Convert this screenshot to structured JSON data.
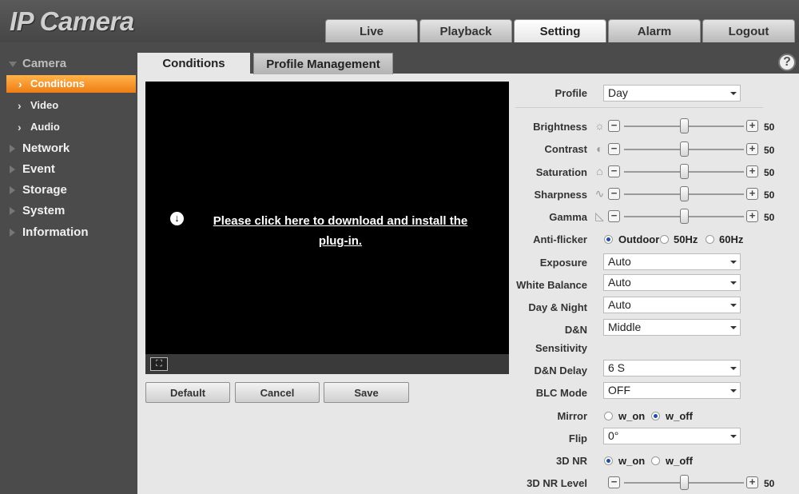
{
  "app": {
    "logo": "IP Camera"
  },
  "topnav": [
    "Live",
    "Playback",
    "Setting",
    "Alarm",
    "Logout"
  ],
  "sidebar": {
    "camera": "Camera",
    "conditions": "Conditions",
    "video": "Video",
    "audio": "Audio",
    "network": "Network",
    "event": "Event",
    "storage": "Storage",
    "system": "System",
    "information": "Information"
  },
  "tabs": {
    "conditions": "Conditions",
    "profile_management": "Profile Management"
  },
  "help": "?",
  "video": {
    "plugin_line1": "Please click here to download and install the",
    "plugin_line2": "plug-in."
  },
  "buttons": {
    "default": "Default",
    "cancel": "Cancel",
    "save": "Save"
  },
  "settings": {
    "profile": {
      "label": "Profile",
      "value": "Day"
    },
    "brightness": {
      "label": "Brightness",
      "value": "50"
    },
    "contrast": {
      "label": "Contrast",
      "value": "50"
    },
    "saturation": {
      "label": "Saturation",
      "value": "50"
    },
    "sharpness": {
      "label": "Sharpness",
      "value": "50"
    },
    "gamma": {
      "label": "Gamma",
      "value": "50"
    },
    "anti_flicker": {
      "label": "Anti-flicker",
      "options": [
        "Outdoor",
        "50Hz",
        "60Hz"
      ],
      "selected": "Outdoor"
    },
    "exposure": {
      "label": "Exposure",
      "value": "Auto"
    },
    "white_balance": {
      "label": "White Balance",
      "value": "Auto"
    },
    "day_night": {
      "label": "Day & Night",
      "value": "Auto"
    },
    "dn_sensitivity": {
      "label_line1": "D&N",
      "label_line2": "Sensitivity",
      "value": "Middle"
    },
    "dn_delay": {
      "label": "D&N Delay",
      "value": "6 S"
    },
    "blc_mode": {
      "label": "BLC Mode",
      "value": "OFF"
    },
    "mirror": {
      "label": "Mirror",
      "options": [
        "w_on",
        "w_off"
      ],
      "selected": "w_off"
    },
    "flip": {
      "label": "Flip",
      "value": "0°"
    },
    "nr3d": {
      "label": "3D NR",
      "options": [
        "w_on",
        "w_off"
      ],
      "selected": "w_on"
    },
    "nr3d_level": {
      "label": "3D NR Level",
      "value": "50"
    }
  }
}
